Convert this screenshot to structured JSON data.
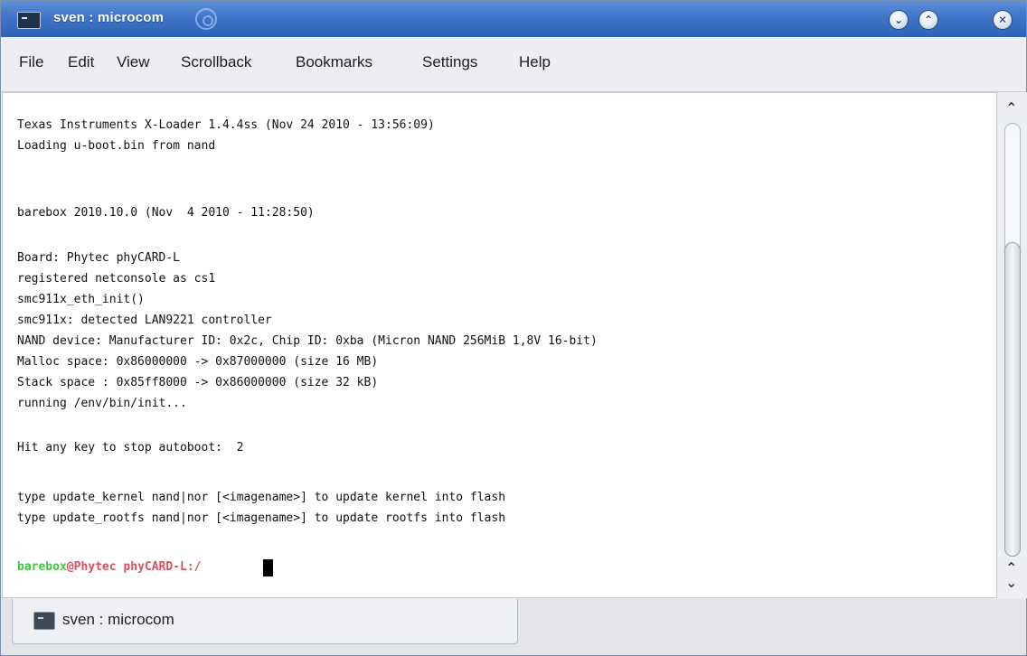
{
  "window": {
    "title": "sven : microcom"
  },
  "menu": {
    "items": [
      "File",
      "Edit",
      "View",
      "Scrollback",
      "Bookmarks",
      "Settings",
      "Help"
    ]
  },
  "terminal": {
    "lines": [
      "Texas Instruments X-Loader 1.4.4ss (Nov 24 2010 - 13:56:09)",
      "Loading u-boot.bin from nand",
      "barebox 2010.10.0 (Nov  4 2010 - 11:28:50)",
      "Board: Phytec phyCARD-L",
      "registered netconsole as cs1",
      "smc911x_eth_init()",
      "smc911x: detected LAN9221 controller",
      "NAND device: Manufacturer ID: 0x2c, Chip ID: 0xba (Micron NAND 256MiB 1,8V 16-bit)",
      "Malloc space: 0x86000000 -> 0x87000000 (size 16 MB)",
      "Stack space : 0x85ff8000 -> 0x86000000 (size 32 kB)",
      "running /env/bin/init...",
      "Hit any key to stop autoboot:  2",
      "type update_kernel nand|nor [<imagename>] to update kernel into flash",
      "type update_rootfs nand|nor [<imagename>] to update rootfs into flash"
    ],
    "prompt": {
      "user": "barebox",
      "host": "@Phytec phyCARD-L:/",
      "suffix": " "
    }
  },
  "tabs": [
    {
      "label": "sven : microcom"
    }
  ],
  "colors": {
    "titlebar": "#3f74c9",
    "prompt_user": "#3fc83f",
    "prompt_host": "#e0505c"
  }
}
